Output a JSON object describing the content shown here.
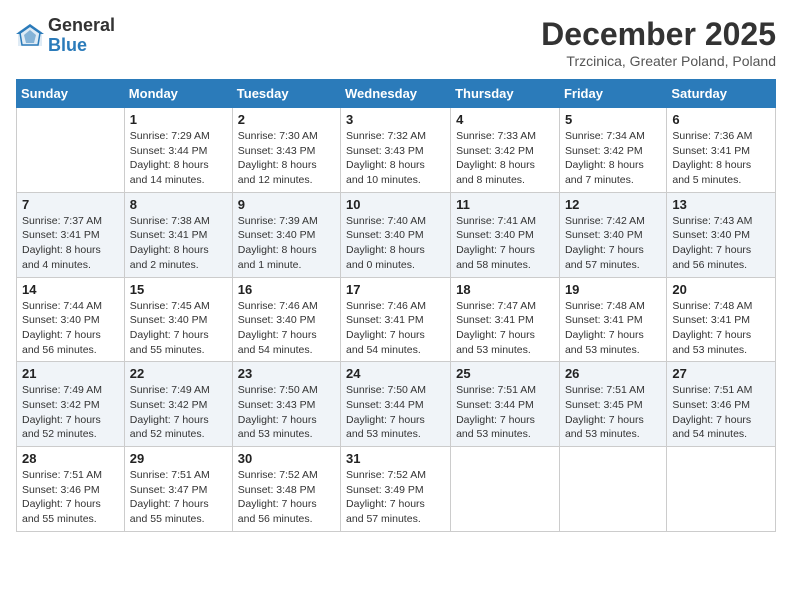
{
  "logo": {
    "general": "General",
    "blue": "Blue"
  },
  "title": "December 2025",
  "subtitle": "Trzcinica, Greater Poland, Poland",
  "days_header": [
    "Sunday",
    "Monday",
    "Tuesday",
    "Wednesday",
    "Thursday",
    "Friday",
    "Saturday"
  ],
  "weeks": [
    [
      {
        "day": "",
        "info": ""
      },
      {
        "day": "1",
        "info": "Sunrise: 7:29 AM\nSunset: 3:44 PM\nDaylight: 8 hours\nand 14 minutes."
      },
      {
        "day": "2",
        "info": "Sunrise: 7:30 AM\nSunset: 3:43 PM\nDaylight: 8 hours\nand 12 minutes."
      },
      {
        "day": "3",
        "info": "Sunrise: 7:32 AM\nSunset: 3:43 PM\nDaylight: 8 hours\nand 10 minutes."
      },
      {
        "day": "4",
        "info": "Sunrise: 7:33 AM\nSunset: 3:42 PM\nDaylight: 8 hours\nand 8 minutes."
      },
      {
        "day": "5",
        "info": "Sunrise: 7:34 AM\nSunset: 3:42 PM\nDaylight: 8 hours\nand 7 minutes."
      },
      {
        "day": "6",
        "info": "Sunrise: 7:36 AM\nSunset: 3:41 PM\nDaylight: 8 hours\nand 5 minutes."
      }
    ],
    [
      {
        "day": "7",
        "info": "Sunrise: 7:37 AM\nSunset: 3:41 PM\nDaylight: 8 hours\nand 4 minutes."
      },
      {
        "day": "8",
        "info": "Sunrise: 7:38 AM\nSunset: 3:41 PM\nDaylight: 8 hours\nand 2 minutes."
      },
      {
        "day": "9",
        "info": "Sunrise: 7:39 AM\nSunset: 3:40 PM\nDaylight: 8 hours\nand 1 minute."
      },
      {
        "day": "10",
        "info": "Sunrise: 7:40 AM\nSunset: 3:40 PM\nDaylight: 8 hours\nand 0 minutes."
      },
      {
        "day": "11",
        "info": "Sunrise: 7:41 AM\nSunset: 3:40 PM\nDaylight: 7 hours\nand 58 minutes."
      },
      {
        "day": "12",
        "info": "Sunrise: 7:42 AM\nSunset: 3:40 PM\nDaylight: 7 hours\nand 57 minutes."
      },
      {
        "day": "13",
        "info": "Sunrise: 7:43 AM\nSunset: 3:40 PM\nDaylight: 7 hours\nand 56 minutes."
      }
    ],
    [
      {
        "day": "14",
        "info": "Sunrise: 7:44 AM\nSunset: 3:40 PM\nDaylight: 7 hours\nand 56 minutes."
      },
      {
        "day": "15",
        "info": "Sunrise: 7:45 AM\nSunset: 3:40 PM\nDaylight: 7 hours\nand 55 minutes."
      },
      {
        "day": "16",
        "info": "Sunrise: 7:46 AM\nSunset: 3:40 PM\nDaylight: 7 hours\nand 54 minutes."
      },
      {
        "day": "17",
        "info": "Sunrise: 7:46 AM\nSunset: 3:41 PM\nDaylight: 7 hours\nand 54 minutes."
      },
      {
        "day": "18",
        "info": "Sunrise: 7:47 AM\nSunset: 3:41 PM\nDaylight: 7 hours\nand 53 minutes."
      },
      {
        "day": "19",
        "info": "Sunrise: 7:48 AM\nSunset: 3:41 PM\nDaylight: 7 hours\nand 53 minutes."
      },
      {
        "day": "20",
        "info": "Sunrise: 7:48 AM\nSunset: 3:41 PM\nDaylight: 7 hours\nand 53 minutes."
      }
    ],
    [
      {
        "day": "21",
        "info": "Sunrise: 7:49 AM\nSunset: 3:42 PM\nDaylight: 7 hours\nand 52 minutes."
      },
      {
        "day": "22",
        "info": "Sunrise: 7:49 AM\nSunset: 3:42 PM\nDaylight: 7 hours\nand 52 minutes."
      },
      {
        "day": "23",
        "info": "Sunrise: 7:50 AM\nSunset: 3:43 PM\nDaylight: 7 hours\nand 53 minutes."
      },
      {
        "day": "24",
        "info": "Sunrise: 7:50 AM\nSunset: 3:44 PM\nDaylight: 7 hours\nand 53 minutes."
      },
      {
        "day": "25",
        "info": "Sunrise: 7:51 AM\nSunset: 3:44 PM\nDaylight: 7 hours\nand 53 minutes."
      },
      {
        "day": "26",
        "info": "Sunrise: 7:51 AM\nSunset: 3:45 PM\nDaylight: 7 hours\nand 53 minutes."
      },
      {
        "day": "27",
        "info": "Sunrise: 7:51 AM\nSunset: 3:46 PM\nDaylight: 7 hours\nand 54 minutes."
      }
    ],
    [
      {
        "day": "28",
        "info": "Sunrise: 7:51 AM\nSunset: 3:46 PM\nDaylight: 7 hours\nand 55 minutes."
      },
      {
        "day": "29",
        "info": "Sunrise: 7:51 AM\nSunset: 3:47 PM\nDaylight: 7 hours\nand 55 minutes."
      },
      {
        "day": "30",
        "info": "Sunrise: 7:52 AM\nSunset: 3:48 PM\nDaylight: 7 hours\nand 56 minutes."
      },
      {
        "day": "31",
        "info": "Sunrise: 7:52 AM\nSunset: 3:49 PM\nDaylight: 7 hours\nand 57 minutes."
      },
      {
        "day": "",
        "info": ""
      },
      {
        "day": "",
        "info": ""
      },
      {
        "day": "",
        "info": ""
      }
    ]
  ]
}
